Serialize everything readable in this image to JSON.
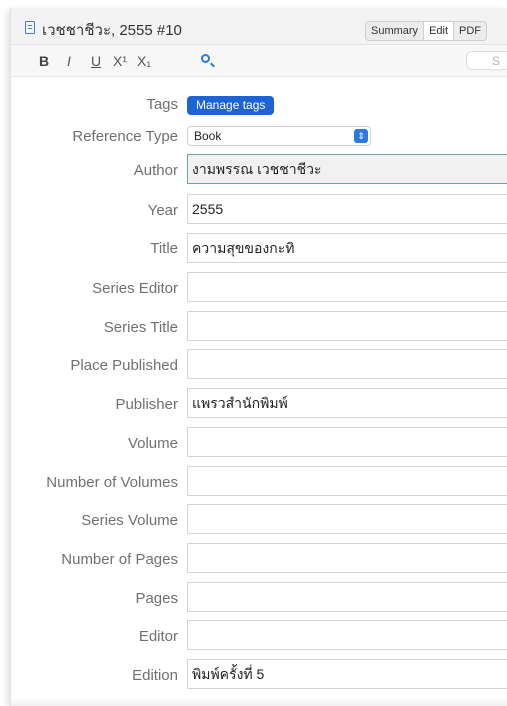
{
  "window": {
    "title": "เวชชาชีวะ, 2555 #10",
    "view_tabs": [
      "Summary",
      "Edit",
      "PDF"
    ],
    "active_tab": "Edit"
  },
  "toolbar": {
    "bold": "B",
    "italic": "I",
    "underline": "U",
    "superscript": "X¹",
    "subscript": "X₁",
    "search_placeholder": "S"
  },
  "tags": {
    "label": "Tags",
    "button": "Manage tags"
  },
  "reference_type": {
    "label": "Reference Type",
    "value": "Book"
  },
  "fields": [
    {
      "label": "Author",
      "value": "งามพรรณ เวชชาชีวะ",
      "focused": true
    },
    {
      "label": "Year",
      "value": "2555"
    },
    {
      "label": "Title",
      "value": "ความสุขของกะทิ"
    },
    {
      "label": "Series Editor",
      "value": ""
    },
    {
      "label": "Series Title",
      "value": ""
    },
    {
      "label": "Place Published",
      "value": ""
    },
    {
      "label": "Publisher",
      "value": "แพรวสำนักพิมพ์"
    },
    {
      "label": "Volume",
      "value": ""
    },
    {
      "label": "Number of Volumes",
      "value": ""
    },
    {
      "label": "Series Volume",
      "value": ""
    },
    {
      "label": "Number of Pages",
      "value": ""
    },
    {
      "label": "Pages",
      "value": ""
    },
    {
      "label": "Editor",
      "value": ""
    },
    {
      "label": "Edition",
      "value": "พิมพ์ครั้งที่ 5"
    }
  ]
}
